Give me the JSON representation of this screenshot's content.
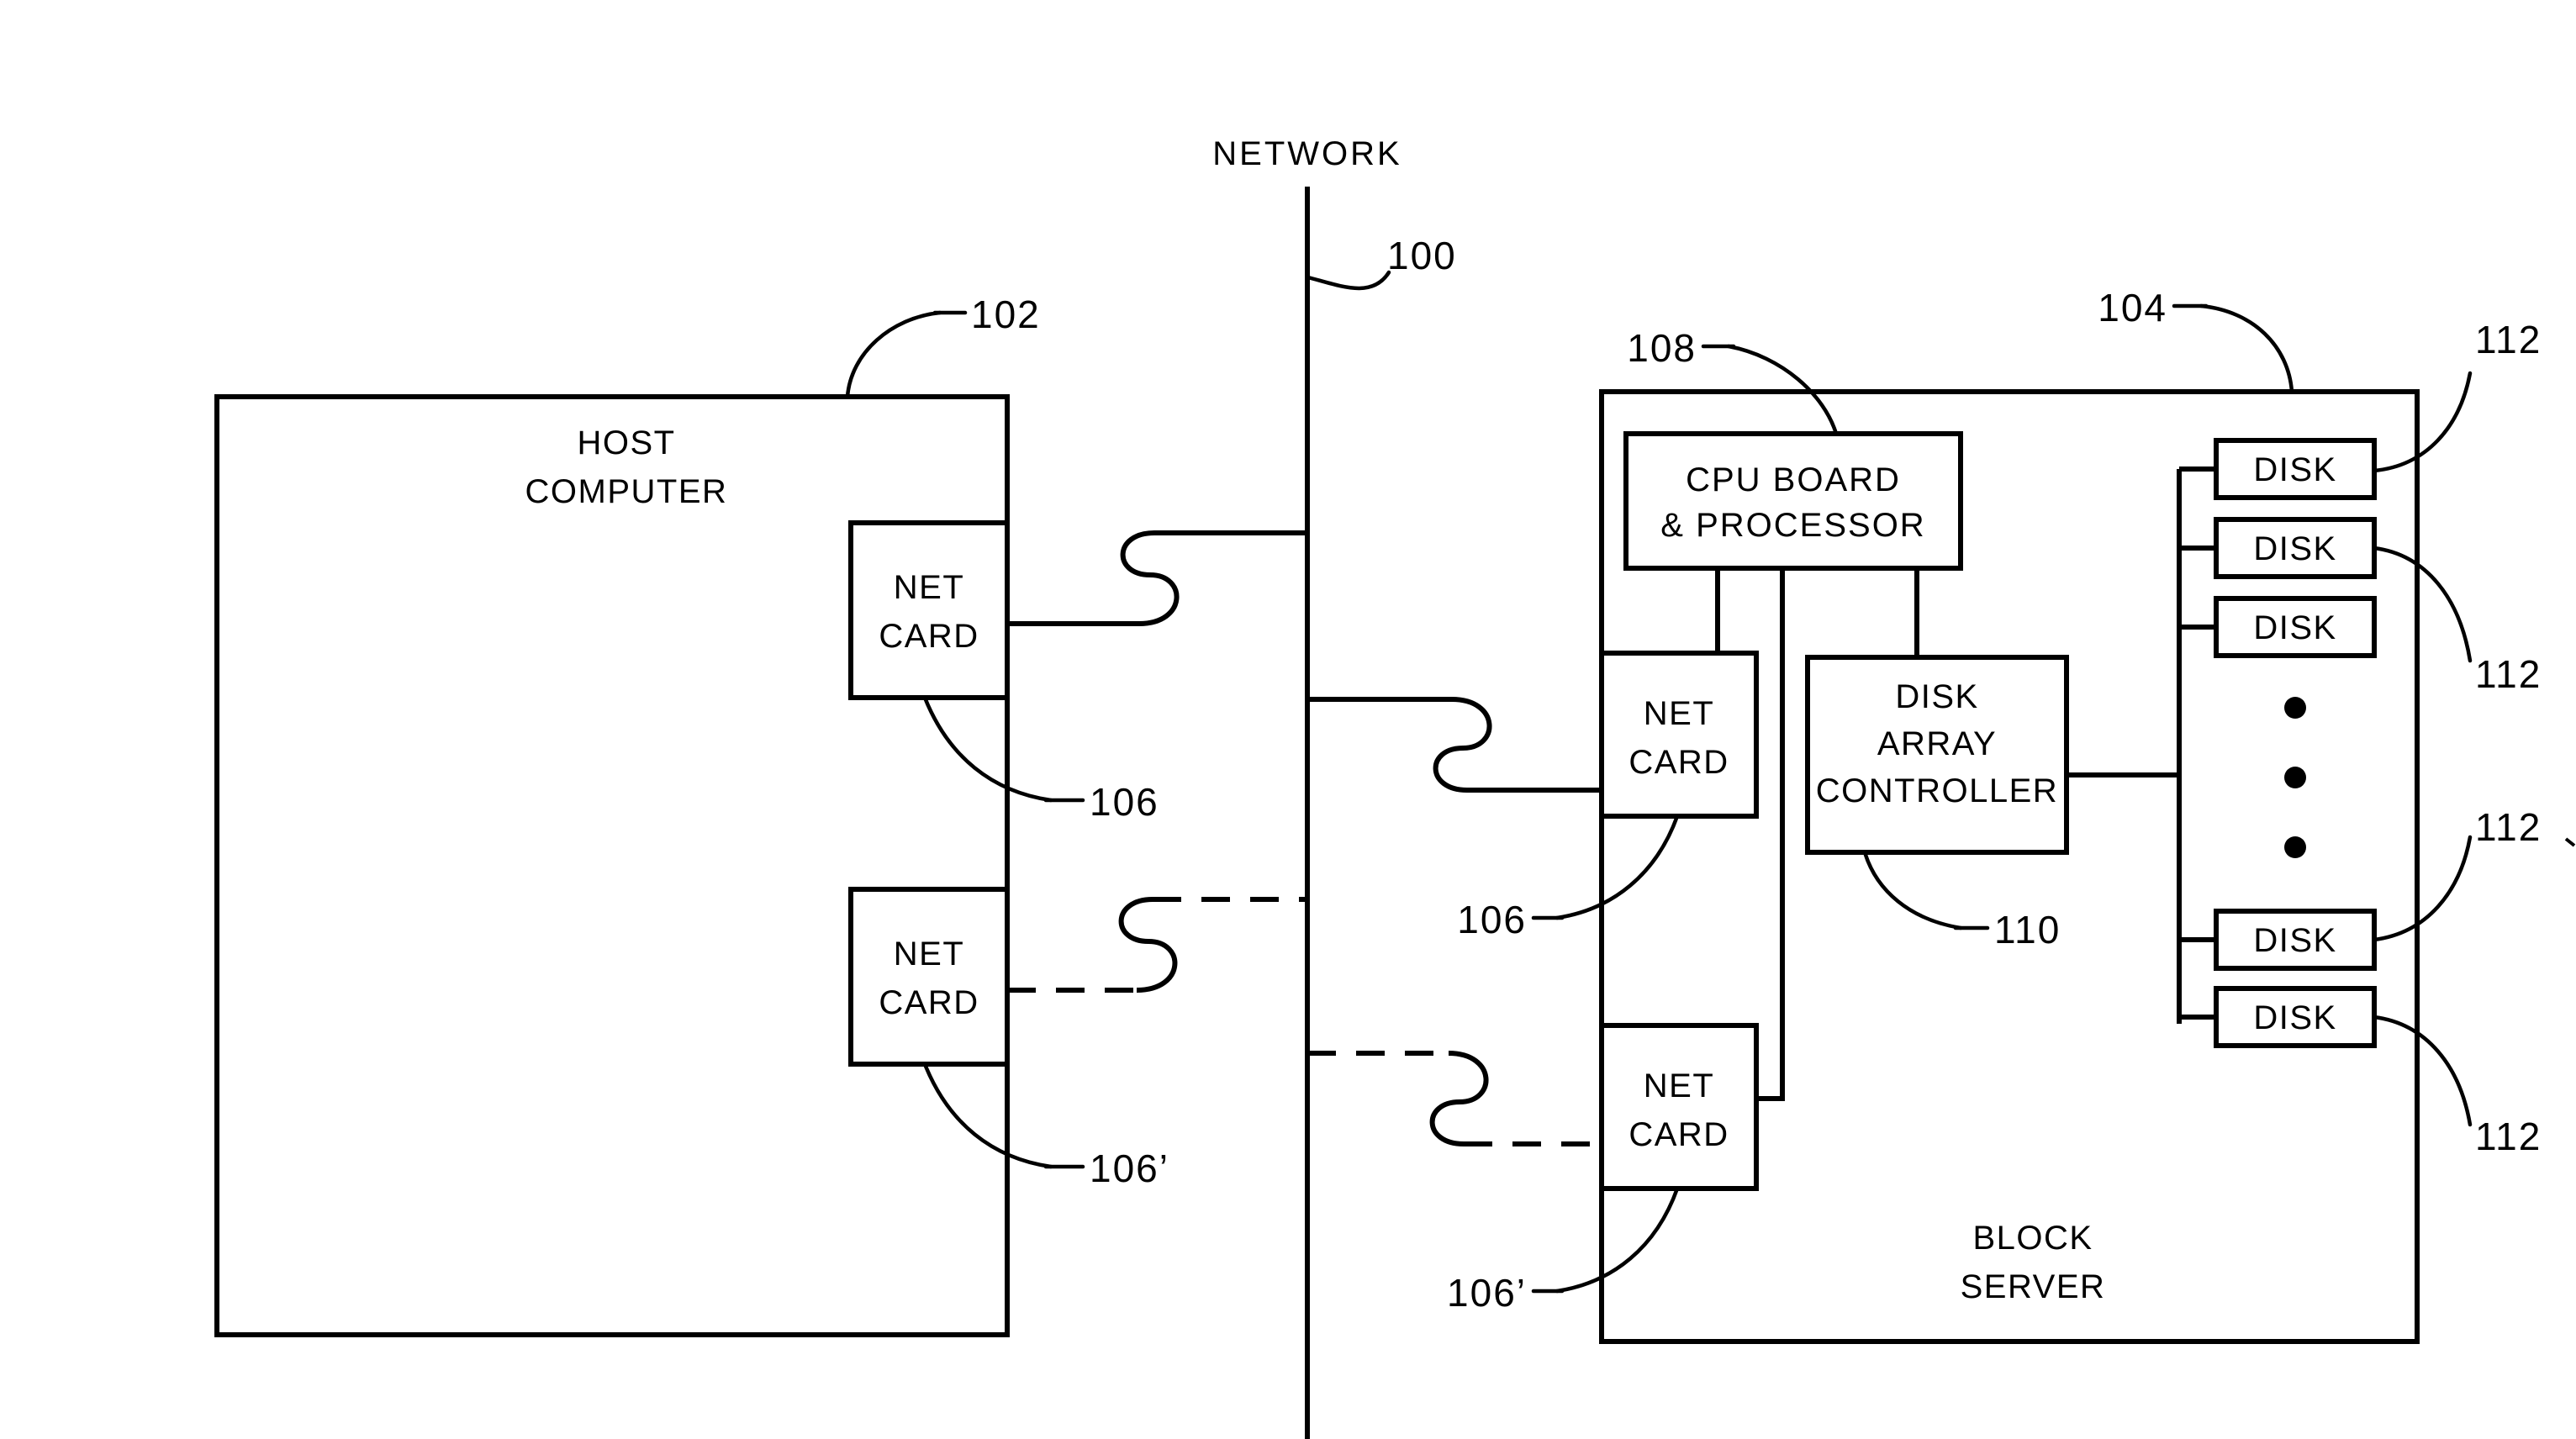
{
  "figure": {
    "type": "patent-block-diagram",
    "background_color": "#ffffff",
    "line_color": "#000000"
  },
  "network": {
    "label": "NETWORK",
    "reference_numeral": "100"
  },
  "host": {
    "title_line1": "HOST",
    "title_line2": "COMPUTER",
    "reference_numeral": "102",
    "net_cards": [
      {
        "line1": "NET",
        "line2": "CARD",
        "reference_numeral": "106",
        "connection_style": "solid"
      },
      {
        "line1": "NET",
        "line2": "CARD",
        "reference_numeral": "106’",
        "connection_style": "dashed"
      }
    ]
  },
  "block_server": {
    "title_line1": "BLOCK",
    "title_line2": "SERVER",
    "reference_numeral": "104",
    "cpu_board": {
      "line1": "CPU  BOARD",
      "line2": "&  PROCESSOR",
      "reference_numeral": "108"
    },
    "disk_array_controller": {
      "line1": "DISK",
      "line2": "ARRAY",
      "line3": "CONTROLLER",
      "reference_numeral": "110"
    },
    "net_cards": [
      {
        "line1": "NET",
        "line2": "CARD",
        "reference_numeral": "106",
        "connection_style": "solid"
      },
      {
        "line1": "NET",
        "line2": "CARD",
        "reference_numeral": "106’",
        "connection_style": "dashed"
      }
    ],
    "disks": {
      "label": "DISK",
      "count_shown": 5,
      "ellipsis_dots": 3,
      "reference_numerals": [
        "112",
        "112",
        "112",
        "112"
      ],
      "items": [
        {
          "label": "DISK"
        },
        {
          "label": "DISK"
        },
        {
          "label": "DISK"
        },
        {
          "label": "DISK"
        },
        {
          "label": "DISK"
        }
      ]
    }
  }
}
